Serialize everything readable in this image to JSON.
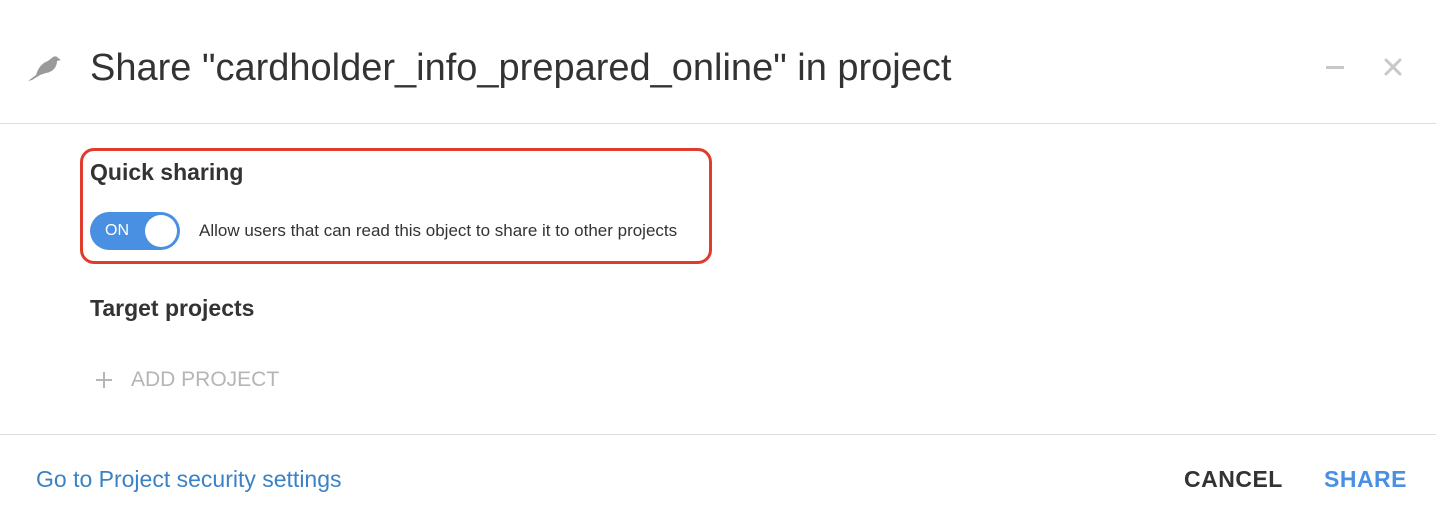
{
  "header": {
    "title": "Share \"cardholder_info_prepared_online\" in project",
    "icon": "bird-icon",
    "minimize_icon": "minimize-icon",
    "close_icon": "close-icon"
  },
  "quick_sharing": {
    "title": "Quick sharing",
    "toggle_label": "ON",
    "toggle_on": true,
    "description": "Allow users that can read this object to share it to other projects"
  },
  "target_projects": {
    "title": "Target projects",
    "add_label": "ADD PROJECT",
    "add_icon": "plus-icon"
  },
  "footer": {
    "link_label": "Go to Project security settings",
    "cancel_label": "CANCEL",
    "share_label": "SHARE"
  },
  "colors": {
    "accent": "#4a90e2",
    "link": "#3b82c4",
    "highlight": "#e03c2c",
    "muted": "#b5b5b5",
    "text": "#333333"
  }
}
